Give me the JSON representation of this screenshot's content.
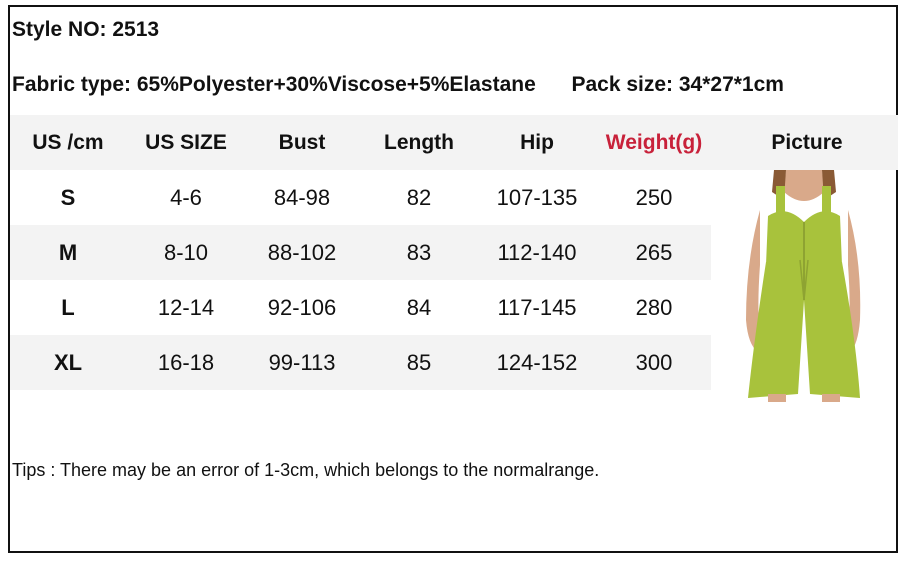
{
  "style": {
    "label": "Style NO:",
    "value": "2513"
  },
  "fabric": {
    "label": "Fabric type:",
    "value": "65%Polyester+30%Viscose+5%Elastane"
  },
  "pack": {
    "label": "Pack size:",
    "value": "34*27*1cm"
  },
  "table": {
    "headers": [
      "US /cm",
      "US SIZE",
      "Bust",
      "Length",
      "Hip",
      "Weight(g)",
      "Picture"
    ],
    "rows": [
      [
        "S",
        "4-6",
        "84-98",
        "82",
        "107-135",
        "250"
      ],
      [
        "M",
        "8-10",
        "88-102",
        "83",
        "112-140",
        "265"
      ],
      [
        "L",
        "12-14",
        "92-106",
        "84",
        "117-145",
        "280"
      ],
      [
        "XL",
        "16-18",
        "99-113",
        "85",
        "124-152",
        "300"
      ]
    ]
  },
  "colors": {
    "weight_header": "#c8213a",
    "row_shade": "#f3f3f3",
    "garment": "#a8c23c"
  },
  "tips": "Tips : There may be an error of 1-3cm, which belongs to the normalrange."
}
